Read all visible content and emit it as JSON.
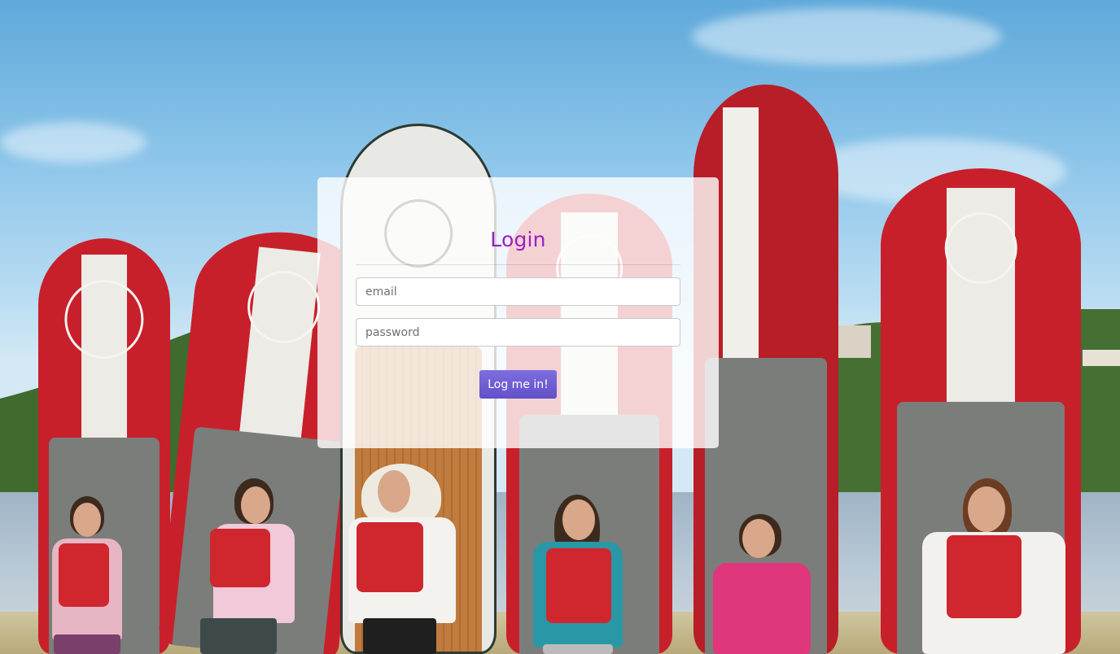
{
  "login": {
    "title": "Login",
    "email_placeholder": "email",
    "password_placeholder": "password",
    "submit_label": "Log me in!"
  },
  "colors": {
    "title": "#9b1fc4",
    "button": "#6d5fd5",
    "board_red": "#c8202a"
  }
}
